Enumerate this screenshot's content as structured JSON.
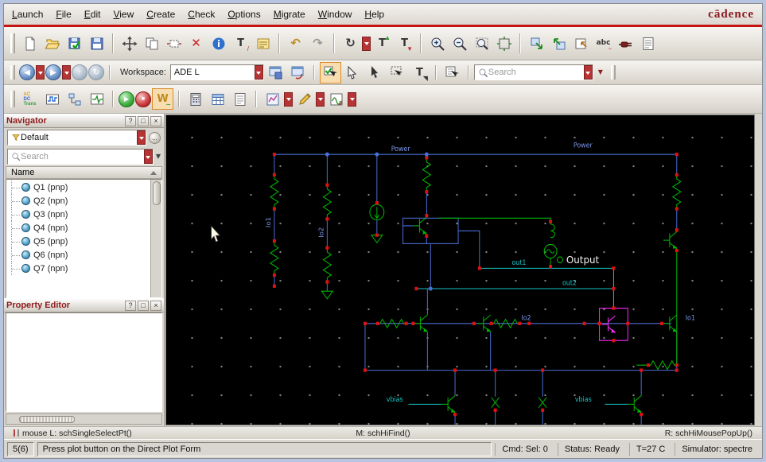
{
  "brand": {
    "logo": "cādence"
  },
  "menubar": {
    "items": [
      "Launch",
      "File",
      "Edit",
      "View",
      "Create",
      "Check",
      "Options",
      "Migrate",
      "Window",
      "Help"
    ]
  },
  "icons": {
    "undo": "↶",
    "redo": "↷",
    "rotate": "↻",
    "back": "◀",
    "forward": "▶",
    "up": "↑",
    "refresh": "↻",
    "text": "T",
    "abc": "abc",
    "w": "W",
    "ac": "AC",
    "dc": "DC",
    "trans": "Trans",
    "play": "▶",
    "stop": "■",
    "help": "?",
    "float": "□",
    "close": "×",
    "more": "...",
    "delete": "✕"
  },
  "toolbar_workspace": {
    "workspace_label": "Workspace:",
    "workspace_value": "ADE L",
    "search_placeholder": "Search"
  },
  "navigator": {
    "title": "Navigator",
    "filter_value": "Default",
    "search_placeholder": "Search",
    "column_header": "Name",
    "items": [
      "Q1 (pnp)",
      "Q2 (npn)",
      "Q3 (npn)",
      "Q4 (npn)",
      "Q5 (pnp)",
      "Q6 (npn)",
      "Q7 (npn)"
    ]
  },
  "property_editor": {
    "title": "Property Editor"
  },
  "canvas": {
    "labels": {
      "power_left": "Power",
      "power_right": "Power",
      "output": "Output",
      "out1": "out1",
      "out2": "out2",
      "io2_mid": "Io2",
      "io1_right": "Io1",
      "io1_left": "Io1",
      "io2_left": "Io2",
      "vbias_left": "vbias",
      "vbias_right": "vbias"
    }
  },
  "statusbar": {
    "mouse_left": "mouse L: schSingleSelectPt()",
    "mouse_middle": "M: schHiFind()",
    "mouse_right": "R: schHiMousePopUp()",
    "page_indicator": "5(6)",
    "hint": "Press plot button on the Direct Plot Form",
    "cmd": "Cmd: Sel: 0",
    "status": "Status: Ready",
    "temperature": "T=27 C",
    "simulator": "Simulator: spectre"
  }
}
